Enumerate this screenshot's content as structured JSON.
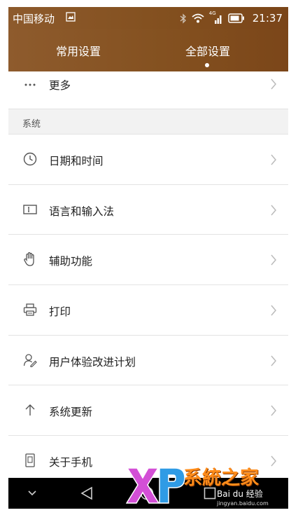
{
  "status_bar": {
    "carrier": "中国移动",
    "network_type": "4G",
    "time": "21:37",
    "icons": [
      "image-icon",
      "bluetooth-icon",
      "wifi-icon",
      "signal-icon",
      "battery-icon"
    ]
  },
  "tabs": [
    {
      "label": "常用设置",
      "active": false
    },
    {
      "label": "全部设置",
      "active": true
    }
  ],
  "list_top": {
    "label": "更多",
    "icon": "more-dots-icon"
  },
  "section": {
    "title": "系统",
    "items": [
      {
        "label": "日期和时间",
        "icon": "clock-icon"
      },
      {
        "label": "语言和输入法",
        "icon": "keyboard-icon"
      },
      {
        "label": "辅助功能",
        "icon": "hand-icon"
      },
      {
        "label": "打印",
        "icon": "printer-icon"
      },
      {
        "label": "用户体验改进计划",
        "icon": "user-edit-icon"
      },
      {
        "label": "系统更新",
        "icon": "arrow-up-icon"
      },
      {
        "label": "关于手机",
        "icon": "phone-icon"
      }
    ]
  },
  "nav_bar": {
    "buttons": [
      "nav-down-icon",
      "back-icon",
      "home-icon",
      "recents-icon"
    ]
  },
  "watermark": {
    "logo": "XP",
    "text": "系統之家",
    "baidu": "Bai du 经验",
    "url": "jingyan.baidu.com"
  },
  "colors": {
    "accent": "#84511f",
    "background": "#f7f7f7",
    "row": "#ffffff",
    "text": "#222222",
    "divider": "#e3e3e3"
  }
}
